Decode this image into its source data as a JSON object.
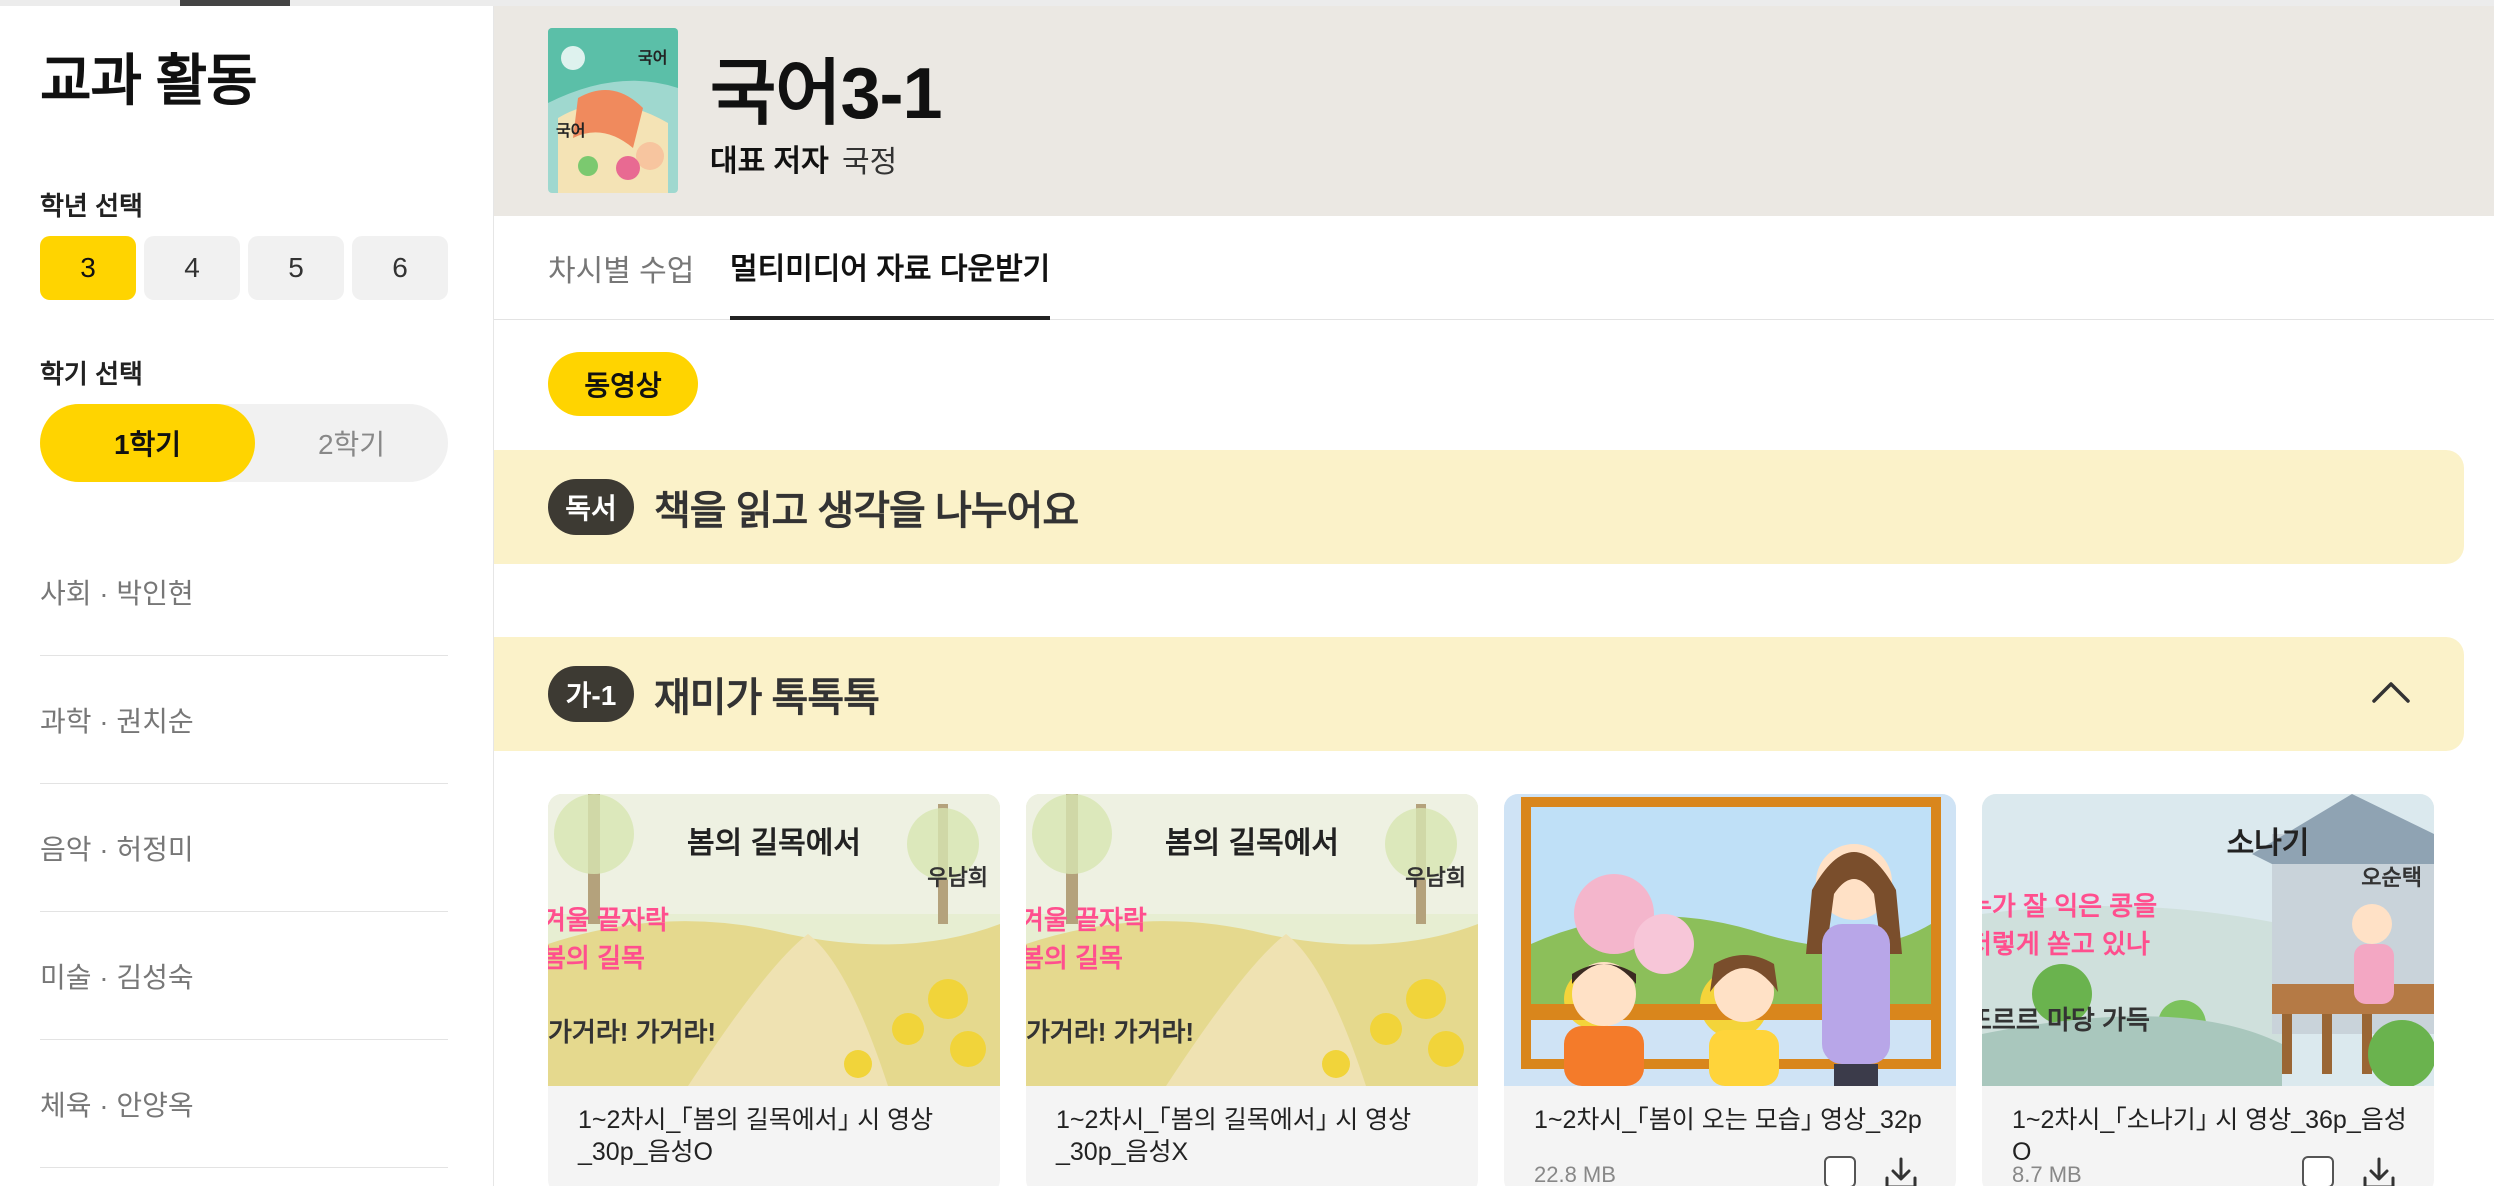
{
  "sidebar": {
    "title": "교과 활동",
    "grade_label": "학년 선택",
    "grades": [
      "3",
      "4",
      "5",
      "6"
    ],
    "selected_grade": "3",
    "semester_label": "학기 선택",
    "semesters": [
      "1학기",
      "2학기"
    ],
    "selected_semester": "1학기",
    "subjects": [
      "사회 · 박인현",
      "과학 · 권치순",
      "음악 · 허정미",
      "미술 · 김성숙",
      "체육 · 안양옥"
    ]
  },
  "header": {
    "title": "국어3-1",
    "author_label": "대표 저자",
    "author_value": "국정",
    "cover_text": "국어"
  },
  "tabs": [
    "차시별 수업",
    "멀티미디어 자료 다운받기"
  ],
  "active_tab": "멀티미디어 자료 다운받기",
  "filter_chip": "동영상",
  "sections": [
    {
      "badge": "독서",
      "title": "책을 읽고 생각을 나누어요"
    },
    {
      "badge": "가-1",
      "title": "재미가 톡톡톡",
      "expanded": true
    }
  ],
  "cards": [
    {
      "thumb_title": "봄의 길목에서",
      "thumb_author": "우남희",
      "verses": [
        "겨울 끝자락",
        "봄의 길목",
        "가거라! 가거라!"
      ],
      "caption": "1~2차시_｢봄의 길목에서｣ 시 영상_30p_음성O",
      "size": ""
    },
    {
      "thumb_title": "봄의 길목에서",
      "thumb_author": "우남희",
      "verses": [
        "겨울 끝자락",
        "봄의 길목",
        "가거라! 가거라!"
      ],
      "caption": "1~2차시_｢봄의 길목에서｣ 시 영상_30p_음성X",
      "size": ""
    },
    {
      "thumb_title": "",
      "thumb_author": "",
      "verses": [],
      "caption": "1~2차시_｢봄이 오는 모습｣ 영상_32p",
      "size": "22.8 MB"
    },
    {
      "thumb_title": "소나기",
      "thumb_author": "오순택",
      "verses": [
        "누가 잘 익은 콩을",
        "저렇게 쏟고 있나",
        "또르르 마당 가득"
      ],
      "caption": "1~2차시_｢소나기｣ 시 영상_36p_음성O",
      "size": "8.7 MB"
    }
  ],
  "colors": {
    "accent_yellow": "#ffd400",
    "band_yellow": "#fbf2c9",
    "header_bg": "#ebe8e3",
    "badge_dark": "#3d3a33"
  },
  "icons": [
    "chevron-up-icon",
    "download-icon",
    "checkbox-icon"
  ]
}
